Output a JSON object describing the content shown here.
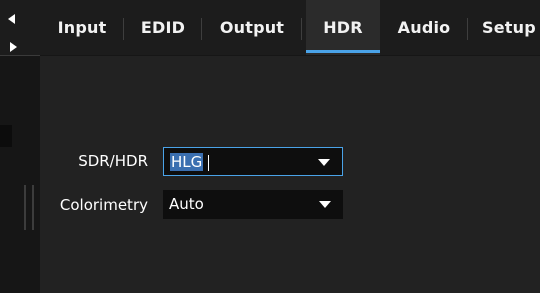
{
  "tabs": [
    {
      "label": "Input",
      "active": false
    },
    {
      "label": "EDID",
      "active": false
    },
    {
      "label": "Output",
      "active": false
    },
    {
      "label": "HDR",
      "active": true
    },
    {
      "label": "Audio",
      "active": false
    },
    {
      "label": "Setup",
      "active": false
    }
  ],
  "hdr": {
    "sdr_hdr": {
      "label": "SDR/HDR",
      "value": "HLG"
    },
    "colorimetry": {
      "label": "Colorimetry",
      "value": "Auto"
    }
  },
  "colors": {
    "accent": "#4aa3e8",
    "selection": "#3b6fb0",
    "background": "#161616",
    "panel": "#222222"
  }
}
